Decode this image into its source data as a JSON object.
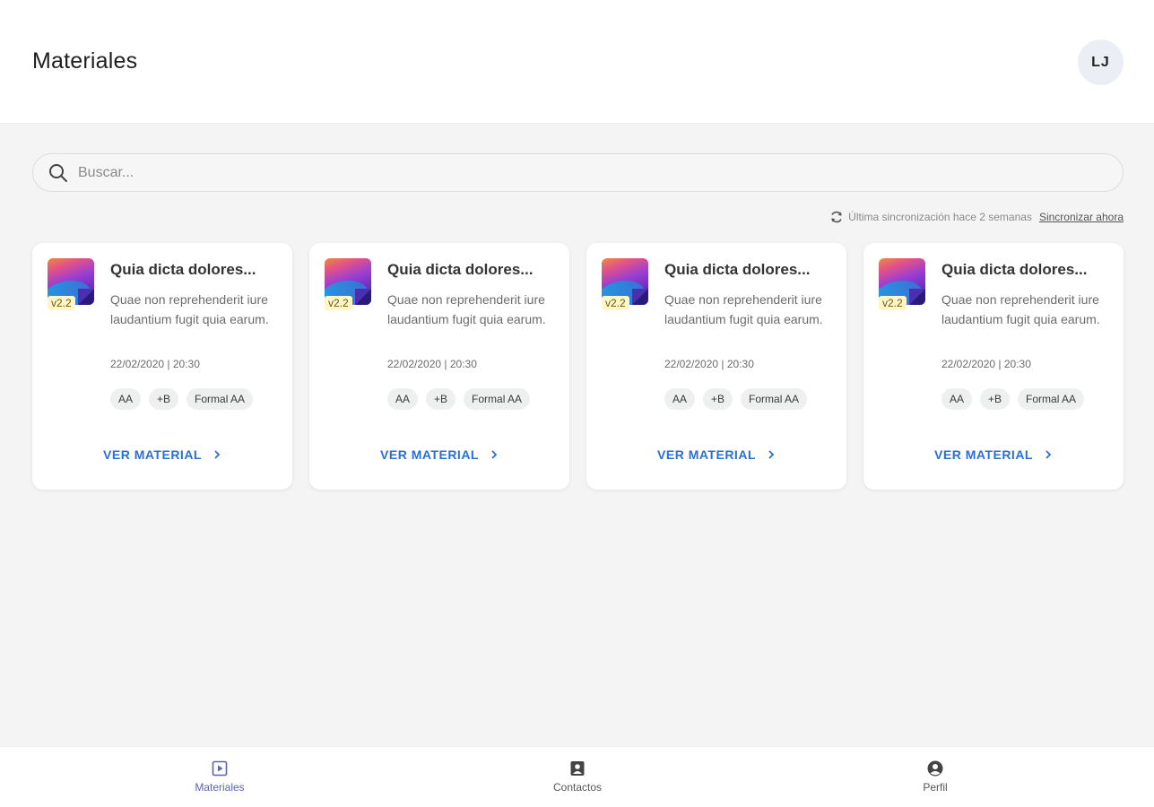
{
  "header": {
    "title": "Materiales",
    "avatar_initials": "LJ"
  },
  "search": {
    "placeholder": "Buscar..."
  },
  "sync": {
    "status": "Última sincronización hace 2 semanas",
    "action": "Sincronizar ahora"
  },
  "cards": [
    {
      "version": "v2.2",
      "title": "Quia dicta dolores...",
      "description": "Quae non reprehenderit iure laudantium fugit quia earum.",
      "date": "22/02/2020 | 20:30",
      "tags": [
        "AA",
        "+B",
        "Formal AA"
      ],
      "action": "VER MATERIAL"
    },
    {
      "version": "v2.2",
      "title": "Quia dicta dolores...",
      "description": "Quae non reprehenderit iure laudantium fugit quia earum.",
      "date": "22/02/2020 | 20:30",
      "tags": [
        "AA",
        "+B",
        "Formal AA"
      ],
      "action": "VER MATERIAL"
    },
    {
      "version": "v2.2",
      "title": "Quia dicta dolores...",
      "description": "Quae non reprehenderit iure laudantium fugit quia earum.",
      "date": "22/02/2020 | 20:30",
      "tags": [
        "AA",
        "+B",
        "Formal AA"
      ],
      "action": "VER MATERIAL"
    },
    {
      "version": "v2.2",
      "title": "Quia dicta dolores...",
      "description": "Quae non reprehenderit iure laudantium fugit quia earum.",
      "date": "22/02/2020 | 20:30",
      "tags": [
        "AA",
        "+B",
        "Formal AA"
      ],
      "action": "VER MATERIAL"
    }
  ],
  "bottom_nav": [
    {
      "label": "Materiales",
      "icon": "materials-icon",
      "active": true
    },
    {
      "label": "Contactos",
      "icon": "contacts-icon",
      "active": false
    },
    {
      "label": "Perfil",
      "icon": "profile-icon",
      "active": false
    }
  ],
  "colors": {
    "accent": "#2a6fd6",
    "nav_active": "#5b63b7",
    "background": "#f4f4f5",
    "version_badge": "#fff6c8"
  }
}
